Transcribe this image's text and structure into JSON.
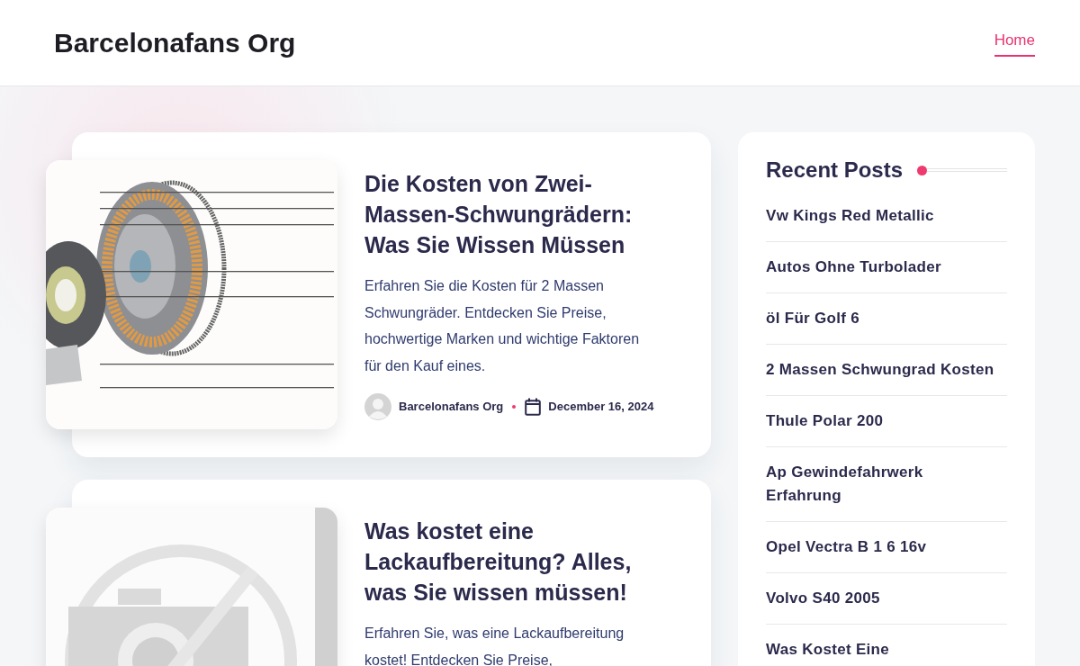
{
  "site_title": "Barcelonafans Org",
  "nav": [
    {
      "label": "Home",
      "selected": true
    }
  ],
  "posts": [
    {
      "title": "Die Kosten von Zwei-Massen-Schwungrädern: Was Sie Wissen Müssen",
      "excerpt": "Erfahren Sie die Kosten für 2 Massen Schwungräder. Entdecken Sie Preise, hochwertige Marken und wichtige Faktoren für den Kauf eines.",
      "author": "Barcelonafans Org",
      "date": "December 16, 2024"
    },
    {
      "title": "Was kostet eine Lackaufbereitung? Alles, was Sie wissen müssen!",
      "excerpt": "Erfahren Sie, was eine Lackaufbereitung kostet! Entdecken Sie Preise,"
    }
  ],
  "sidebar": {
    "title": "Recent Posts",
    "items": [
      "Vw Kings Red Metallic",
      "Autos Ohne Turbolader",
      "öl Für Golf 6",
      "2 Massen Schwungrad Kosten",
      "Thule Polar 200",
      "Ap Gewindefahrwerk Erfahrung",
      "Opel Vectra B 1 6 16v",
      "Volvo S40 2005",
      "Was Kostet Eine"
    ]
  }
}
